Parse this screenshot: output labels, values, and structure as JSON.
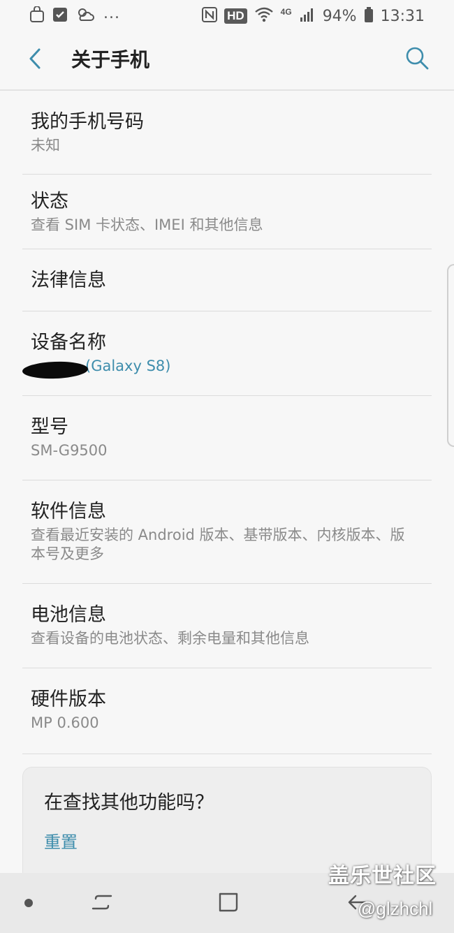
{
  "status_bar": {
    "battery": "94%",
    "time": "13:31",
    "hd": "HD",
    "network": "4G",
    "overflow": "...",
    "icons_left": [
      "bag-icon",
      "sim-icon",
      "weather-icon"
    ],
    "icons_right": [
      "nfc-icon",
      "wifi-icon",
      "signal-icon",
      "battery-icon"
    ]
  },
  "header": {
    "title": "关于手机",
    "back_icon": "back-arrow-icon",
    "search_icon": "search-icon"
  },
  "items": [
    {
      "title": "我的手机号码",
      "summary": "未知"
    },
    {
      "title": "状态",
      "summary": "查看 SIM 卡状态、IMEI 和其他信息"
    },
    {
      "title": "法律信息",
      "summary": ""
    },
    {
      "title": "设备名称",
      "summary": "(Galaxy S8)"
    },
    {
      "title": "型号",
      "summary": "SM-G9500"
    },
    {
      "title": "软件信息",
      "summary": "查看最近安装的 Android 版本、基带版本、内核版本、版本号及更多"
    },
    {
      "title": "电池信息",
      "summary": "查看设备的电池状态、剩余电量和其他信息"
    },
    {
      "title": "硬件版本",
      "summary": "MP 0.600"
    }
  ],
  "suggestion_card": {
    "title": "在查找其他功能吗？",
    "link": "重置"
  },
  "watermark": {
    "site": "盖乐世社区",
    "handle": "@glzhchl"
  },
  "colors": {
    "accent": "#3e8dac",
    "background": "#f7f7f7",
    "text_primary": "#222222",
    "text_secondary": "#8a8a8a"
  }
}
